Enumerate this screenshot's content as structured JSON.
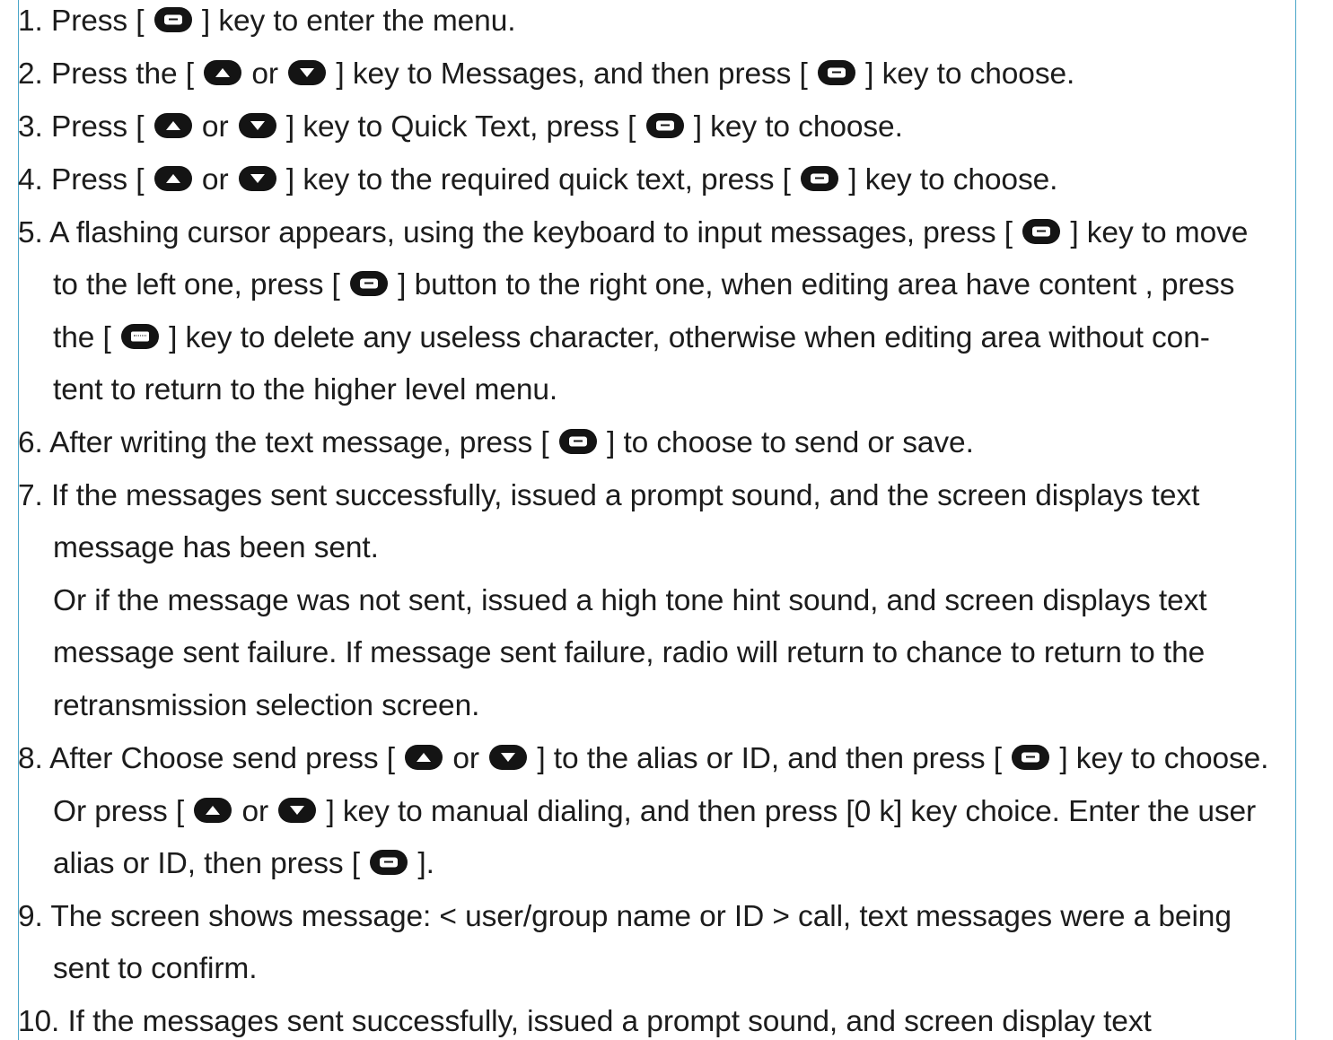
{
  "icons": {
    "menu_key": "menu-key-icon",
    "up_key": "up-key-icon",
    "down_key": "down-key-icon",
    "keyboard_key": "keyboard-key-icon"
  },
  "lines": [
    [
      "1. Press [ ",
      "@menu",
      " ] key to enter the menu."
    ],
    [
      "2. Press  the [ ",
      "@up",
      " or ",
      "@down",
      " ] key to Messages, and then press [ ",
      "@menu",
      " ] key to choose."
    ],
    [
      "3. Press [ ",
      "@up",
      " or ",
      "@down",
      " ] key to Quick Text, press [ ",
      "@menu",
      " ] key to choose."
    ],
    [
      "4. Press [ ",
      "@up",
      " or ",
      "@down",
      " ] key to the required quick text, press [ ",
      "@menu",
      " ] key to choose."
    ],
    [
      "5. A flashing cursor appears, using the keyboard to input messages, press [ ",
      "@menu",
      " ] key to move"
    ],
    [
      "to the left one, press [ ",
      "@menu",
      " ] button to the right one, when editing area have content , press"
    ],
    [
      "the [ ",
      "@kb",
      " ] key to delete any useless character, otherwise when editing area without con-"
    ],
    [
      "tent to return to the higher level menu."
    ],
    [
      "6. After writing the text message, press [ ",
      "@menu",
      " ]  to choose to send or save."
    ],
    [
      "7. If the messages sent successfully, issued a prompt sound, and the screen displays text"
    ],
    [
      "message has been sent."
    ],
    [
      "Or if the message was not sent, issued a high tone hint sound, and screen displays text"
    ],
    [
      "message sent failure. If message sent failure, radio will return to  chance to return to the"
    ],
    [
      "retransmission selection screen."
    ],
    [
      "8. After Choose send press [ ",
      "@up",
      " or ",
      "@down",
      " ] to the alias or ID, and then press [ ",
      "@menu",
      " ] key to choose."
    ],
    [
      "Or  press  [ ",
      "@up",
      " or ",
      "@down",
      " ] key to manual dialing, and then press [0 k] key choice. Enter the user"
    ],
    [
      "alias or ID, then  press   [ ",
      "@menu",
      " ]."
    ],
    [
      "9. The screen shows message: < user/group name or ID > call, text messages were a being"
    ],
    [
      "sent to confirm."
    ],
    [
      "10. If the messages sent successfully, issued a prompt sound, and screen display text"
    ]
  ]
}
